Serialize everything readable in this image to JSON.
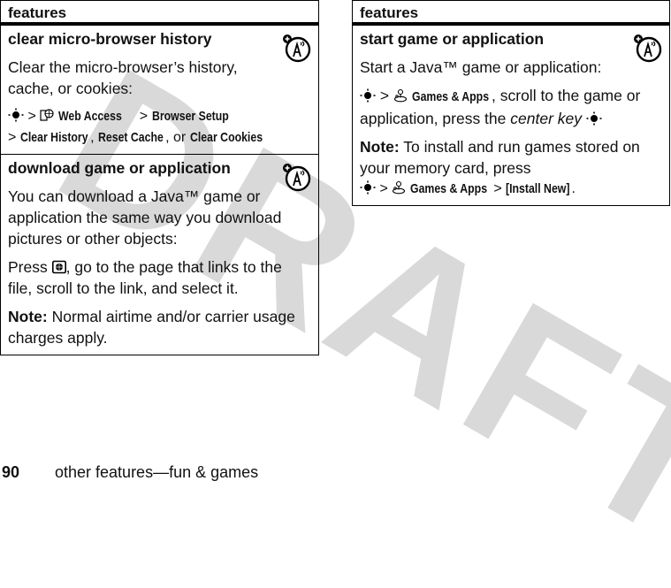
{
  "watermark": "DRAFT",
  "left_table": {
    "header": "features",
    "rows": [
      {
        "title": "clear micro-browser history",
        "icon": "network-feature-icon",
        "description": "Clear the micro-browser’s history, cache, or cookies:",
        "path": {
          "nav_icon": "nav-key-icon",
          "sep": ">",
          "web_icon": "web-access-icon",
          "item1": "Web Access",
          "item2": "Browser Setup",
          "item3": "Clear History",
          "comma": ",",
          "item4": "Reset Cache",
          "or": ", or",
          "item5": "Clear Cookies"
        }
      },
      {
        "title": "download game or application",
        "icon": "network-feature-icon",
        "description": "You can download a Java™ game or application the same way you download pictures or other objects:",
        "press_prefix": "Press",
        "press_icon": "browser-key-icon",
        "press_suffix": ", go to the page that links to the file, scroll to the link, and select it.",
        "note_label": "Note:",
        "note_text": "Normal airtime and/or carrier usage charges apply."
      }
    ]
  },
  "right_table": {
    "header": "features",
    "rows": [
      {
        "title": "start game or application",
        "icon": "network-feature-icon",
        "description": "Start a Java™ game or application:",
        "path_item": "Games & Apps",
        "path_suffix": ", scroll to the game or application, press the",
        "center_key": "center key",
        "note_label": "Note:",
        "note_text": "To install and run games stored on your memory card, press",
        "install_item": "[Install New]",
        "period": "."
      }
    ]
  },
  "footer": {
    "page_number": "90",
    "section_title": "other features—fun & games"
  }
}
